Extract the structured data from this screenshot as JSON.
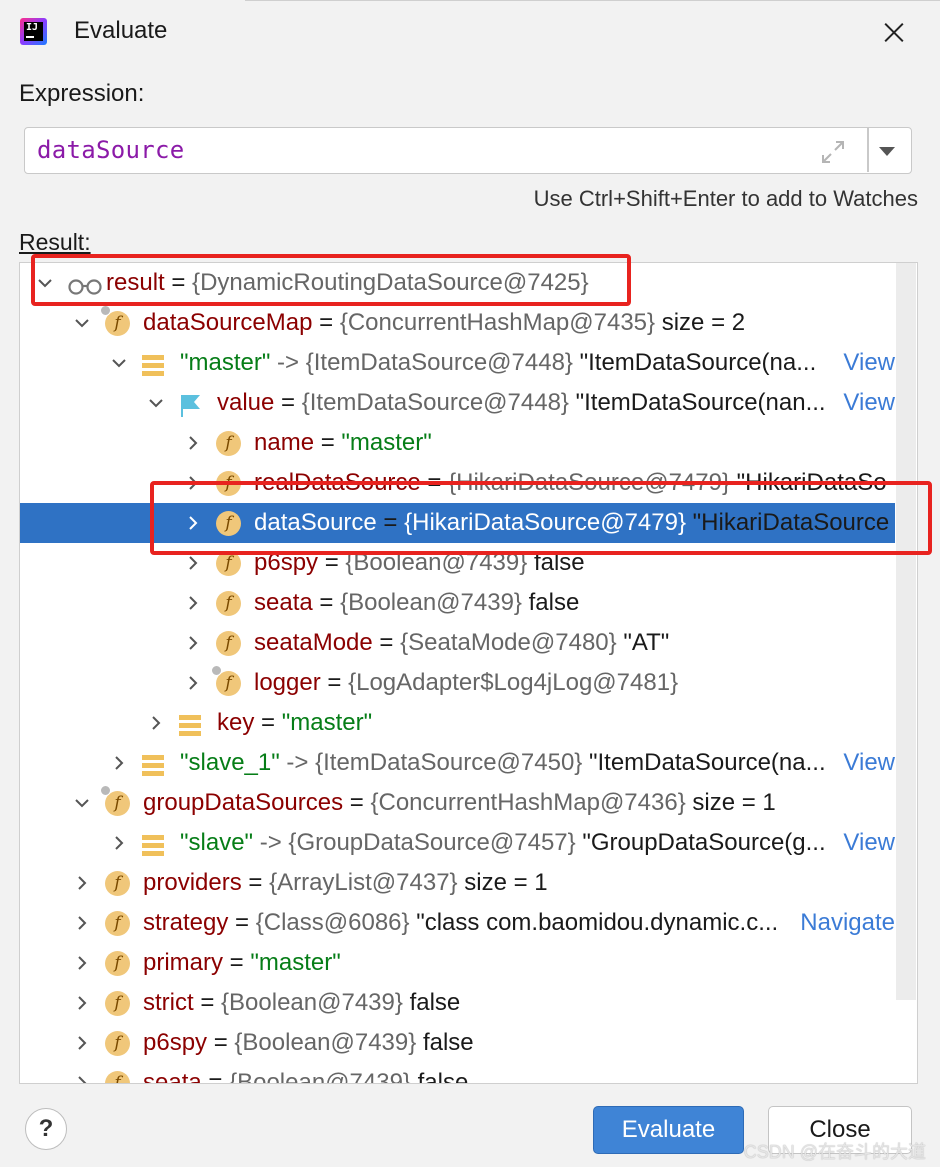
{
  "window": {
    "title": "Evaluate"
  },
  "expression": {
    "label": "Expression:",
    "value": "dataSource",
    "hint": "Use Ctrl+Shift+Enter to add to Watches"
  },
  "result": {
    "label": "Result:"
  },
  "tree": [
    {
      "depth": 0,
      "expanded": true,
      "icon": "glasses-icon",
      "name": "result",
      "eq": " = ",
      "type": "{DynamicRoutingDataSource@7425}",
      "extra": "",
      "extra_kind": "",
      "link": ""
    },
    {
      "depth": 1,
      "expanded": true,
      "icon": "field-icon",
      "lock": true,
      "name": "dataSourceMap",
      "eq": " = ",
      "type": "{ConcurrentHashMap@7435}",
      "extra": "  size = 2",
      "extra_kind": "plain",
      "link": ""
    },
    {
      "depth": 2,
      "expanded": true,
      "icon": "map-entry-icon",
      "name": "\"master\"",
      "name_kind": "str",
      "eq": " -> ",
      "eq_kind": "type",
      "type": "{ItemDataSource@7448}",
      "extra": " \"ItemDataSource(na...",
      "extra_kind": "plain",
      "link": "View"
    },
    {
      "depth": 3,
      "expanded": true,
      "icon": "flag-icon",
      "name": "value",
      "eq": " = ",
      "type": "{ItemDataSource@7448}",
      "extra": " \"ItemDataSource(nan...",
      "extra_kind": "plain",
      "link": "View"
    },
    {
      "depth": 4,
      "expanded": false,
      "icon": "field-icon",
      "name": "name",
      "eq": " = ",
      "type": "",
      "extra": "\"master\"",
      "extra_kind": "str",
      "link": ""
    },
    {
      "depth": 4,
      "expanded": false,
      "icon": "field-icon",
      "name": "realDataSource",
      "eq": " = ",
      "type": "{HikariDataSource@7479}",
      "extra": " \"HikariDataSo",
      "extra_kind": "plain",
      "link": ""
    },
    {
      "depth": 4,
      "expanded": false,
      "icon": "field-icon",
      "name": "dataSource",
      "eq": " = ",
      "type": "{HikariDataSource@7479}",
      "extra": " \"HikariDataSource",
      "extra_kind": "plain",
      "link": "",
      "selected": true
    },
    {
      "depth": 4,
      "expanded": false,
      "icon": "field-icon",
      "name": "p6spy",
      "eq": " = ",
      "type": "{Boolean@7439}",
      "extra": " false",
      "extra_kind": "plain",
      "link": ""
    },
    {
      "depth": 4,
      "expanded": false,
      "icon": "field-icon",
      "name": "seata",
      "eq": " = ",
      "type": "{Boolean@7439}",
      "extra": " false",
      "extra_kind": "plain",
      "link": ""
    },
    {
      "depth": 4,
      "expanded": false,
      "icon": "field-icon",
      "name": "seataMode",
      "eq": " = ",
      "type": "{SeataMode@7480}",
      "extra": " \"AT\"",
      "extra_kind": "plain",
      "link": ""
    },
    {
      "depth": 4,
      "expanded": false,
      "icon": "field-icon",
      "lock": true,
      "name": "logger",
      "eq": " = ",
      "type": "{LogAdapter$Log4jLog@7481}",
      "extra": "",
      "extra_kind": "",
      "link": ""
    },
    {
      "depth": 3,
      "expanded": false,
      "icon": "map-entry-icon",
      "name": "key",
      "eq": " = ",
      "type": "",
      "extra": "\"master\"",
      "extra_kind": "str",
      "link": ""
    },
    {
      "depth": 2,
      "expanded": false,
      "icon": "map-entry-icon",
      "name": "\"slave_1\"",
      "name_kind": "str",
      "eq": " -> ",
      "eq_kind": "type",
      "type": "{ItemDataSource@7450}",
      "extra": " \"ItemDataSource(na...",
      "extra_kind": "plain",
      "link": "View"
    },
    {
      "depth": 1,
      "expanded": true,
      "icon": "field-icon",
      "lock": true,
      "name": "groupDataSources",
      "eq": " = ",
      "type": "{ConcurrentHashMap@7436}",
      "extra": "  size = 1",
      "extra_kind": "plain",
      "link": ""
    },
    {
      "depth": 2,
      "expanded": false,
      "icon": "map-entry-icon",
      "name": "\"slave\"",
      "name_kind": "str",
      "eq": " -> ",
      "eq_kind": "type",
      "type": "{GroupDataSource@7457}",
      "extra": " \"GroupDataSource(g...",
      "extra_kind": "plain",
      "link": "View"
    },
    {
      "depth": 1,
      "expanded": false,
      "icon": "field-icon",
      "name": "providers",
      "eq": " = ",
      "type": "{ArrayList@7437}",
      "extra": "  size = 1",
      "extra_kind": "plain",
      "link": ""
    },
    {
      "depth": 1,
      "expanded": false,
      "icon": "field-icon",
      "name": "strategy",
      "eq": " = ",
      "type": "{Class@6086}",
      "extra": " \"class com.baomidou.dynamic.c...",
      "extra_kind": "plain",
      "link": "Navigate"
    },
    {
      "depth": 1,
      "expanded": false,
      "icon": "field-icon",
      "name": "primary",
      "eq": " = ",
      "type": "",
      "extra": "\"master\"",
      "extra_kind": "str",
      "link": ""
    },
    {
      "depth": 1,
      "expanded": false,
      "icon": "field-icon",
      "name": "strict",
      "eq": " = ",
      "type": "{Boolean@7439}",
      "extra": " false",
      "extra_kind": "plain",
      "link": ""
    },
    {
      "depth": 1,
      "expanded": false,
      "icon": "field-icon",
      "name": "p6spy",
      "eq": " = ",
      "type": "{Boolean@7439}",
      "extra": " false",
      "extra_kind": "plain",
      "link": ""
    },
    {
      "depth": 1,
      "expanded": false,
      "icon": "field-icon",
      "name": "seata",
      "eq": " = ",
      "type": "{Boolean@7439}",
      "extra": " false",
      "extra_kind": "plain",
      "link": ""
    }
  ],
  "buttons": {
    "help": "?",
    "evaluate": "Evaluate",
    "close": "Close"
  },
  "watermark": "CSDN @在奋斗的大道",
  "colors": {
    "selection": "#2f72c4",
    "highlight_box": "#e8231f",
    "evaluate_button": "#3f84d6"
  }
}
